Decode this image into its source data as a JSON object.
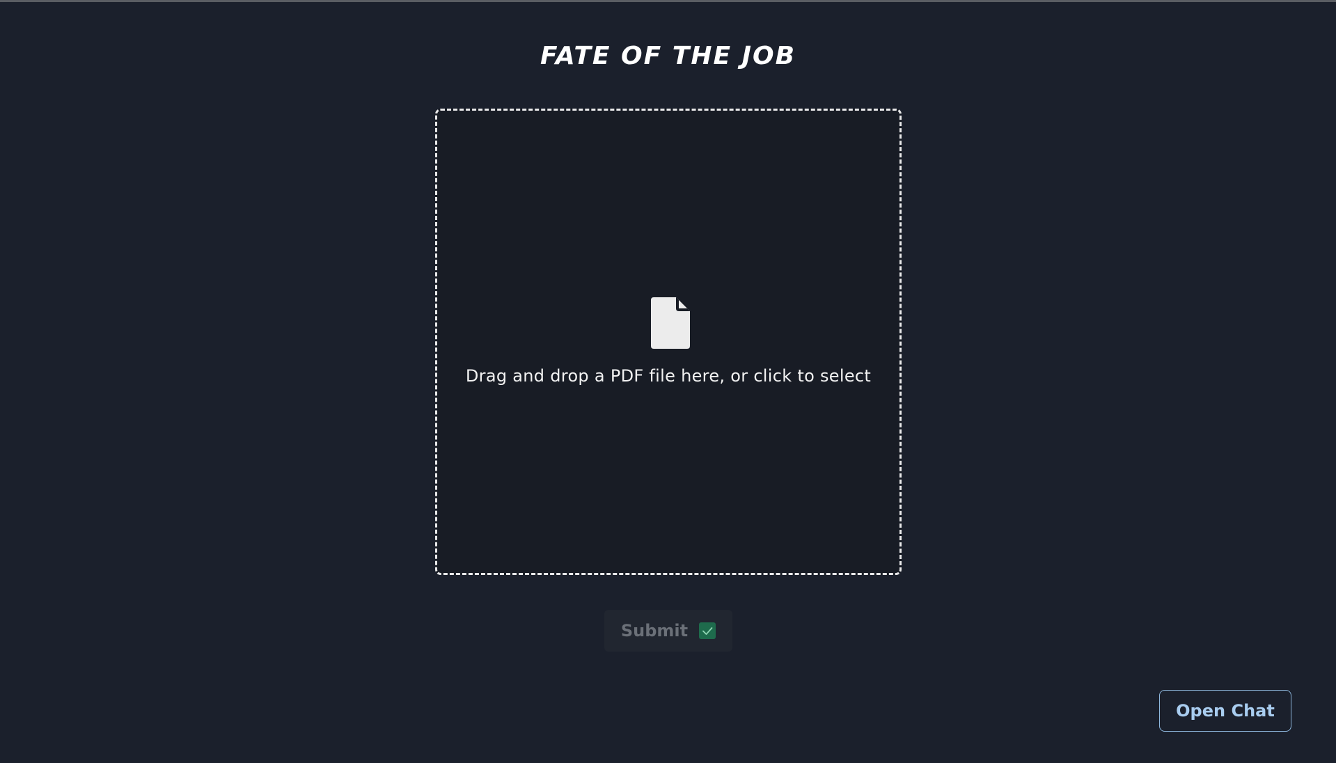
{
  "page": {
    "title": "FATE OF THE JOB"
  },
  "upload": {
    "instruction": "Drag and drop a PDF file here, or click to select",
    "icon": "file-icon"
  },
  "submit": {
    "label": "Submit",
    "icon": "check-icon",
    "disabled": true
  },
  "chat": {
    "open_label": "Open Chat"
  },
  "colors": {
    "background": "#1b202c",
    "dropzone_background": "#181c25",
    "dropzone_border": "#e9e9ea",
    "submit_background": "#212630",
    "submit_text": "#6b7078",
    "check_green": "#1e6b4c",
    "chat_accent": "#a9cdf0"
  }
}
